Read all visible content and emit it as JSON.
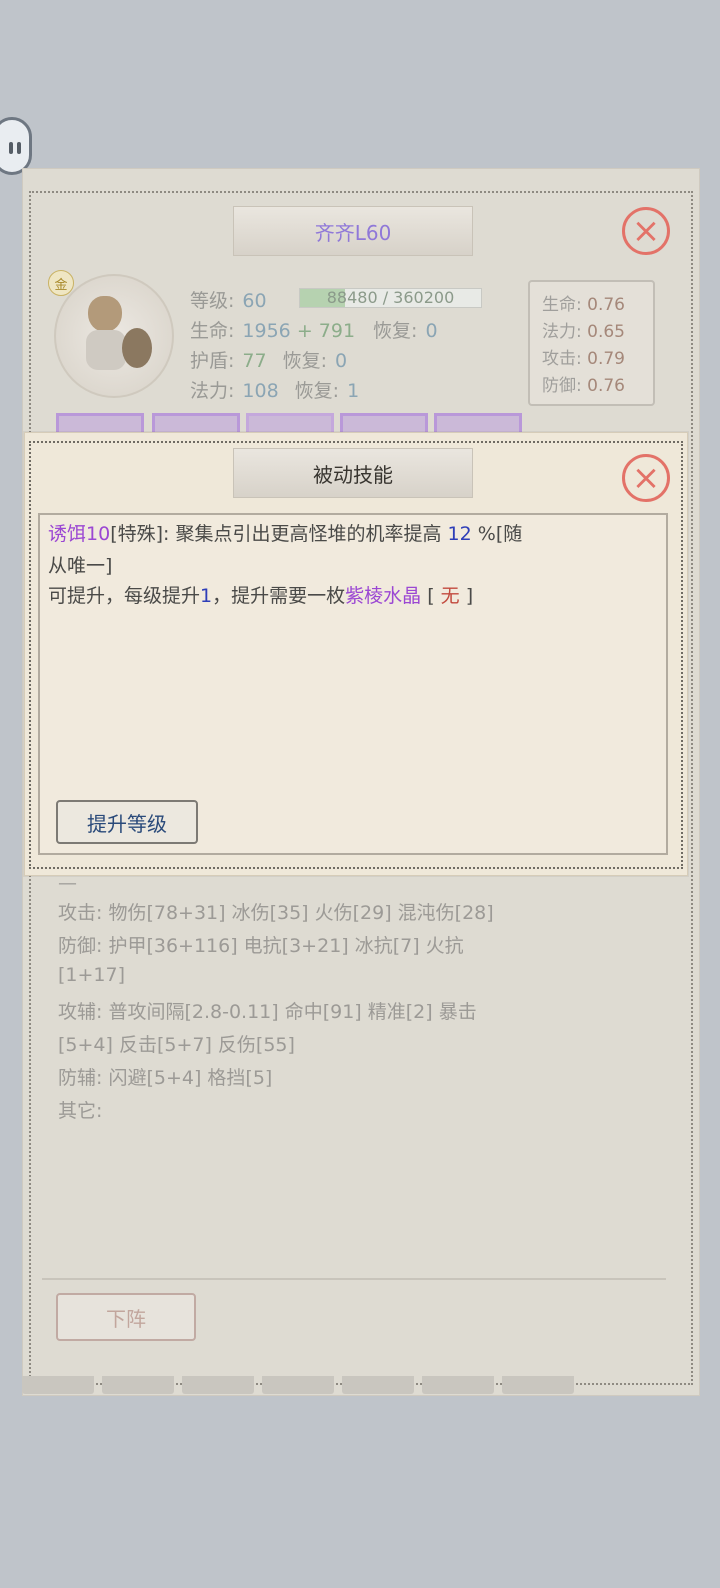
{
  "main_panel": {
    "title": "齐齐L60",
    "portrait_badge": "金",
    "stats": {
      "level_label": "等级:",
      "level_value": "60",
      "exp_text": "88480 / 360200",
      "exp_fraction": 0.246,
      "hp_label": "生命:",
      "hp_value": "1956",
      "hp_bonus": "+ 791",
      "hp_regen_label": "恢复:",
      "hp_regen_value": "0",
      "shield_label": "护盾:",
      "shield_value": "77",
      "shield_regen_label": "恢复:",
      "shield_regen_value": "0",
      "mana_label": "法力:",
      "mana_value": "108",
      "mana_regen_label": "恢复:",
      "mana_regen_value": "1"
    },
    "growth": [
      {
        "label": "生命:",
        "value": "0.76"
      },
      {
        "label": "法力:",
        "value": "0.65"
      },
      {
        "label": "攻击:",
        "value": "0.79"
      },
      {
        "label": "防御:",
        "value": "0.76"
      }
    ],
    "attributes": {
      "attack_label": "攻击:",
      "attack_values": "物伤[78+31] 冰伤[35] 火伤[29] 混沌伤[28]",
      "defense_label": "防御:",
      "defense_values": "护甲[36+116] 电抗[3+21] 冰抗[7] 火抗",
      "defense_cont": "[1+17]",
      "atk_aux_label": "攻辅:",
      "atk_aux_values": "普攻间隔[2.8-0.11] 命中[91] 精准[2] 暴击",
      "atk_aux_cont": "[5+4] 反击[5+7] 反伤[55]",
      "def_aux_label": "防辅:",
      "def_aux_values": "闪避[5+4] 格挡[5]",
      "other_label": "其它:"
    },
    "dismiss_button": "下阵"
  },
  "popup": {
    "title": "被动技能",
    "skill_name": "诱饵10",
    "skill_tag": "[特殊]:",
    "skill_desc": "聚集点引出更高怪堆的机率提高",
    "skill_value": "12",
    "skill_suffix": "%[随",
    "skill_suffix2": "从唯一]",
    "upgrade_prefix": "可提升，每级提升",
    "upgrade_step": "1",
    "upgrade_mid": "，提升需要一枚",
    "upgrade_item": "紫棱水晶",
    "bracket_open": "[",
    "upgrade_status": "无",
    "bracket_close": "]",
    "upgrade_button": "提升等级"
  }
}
